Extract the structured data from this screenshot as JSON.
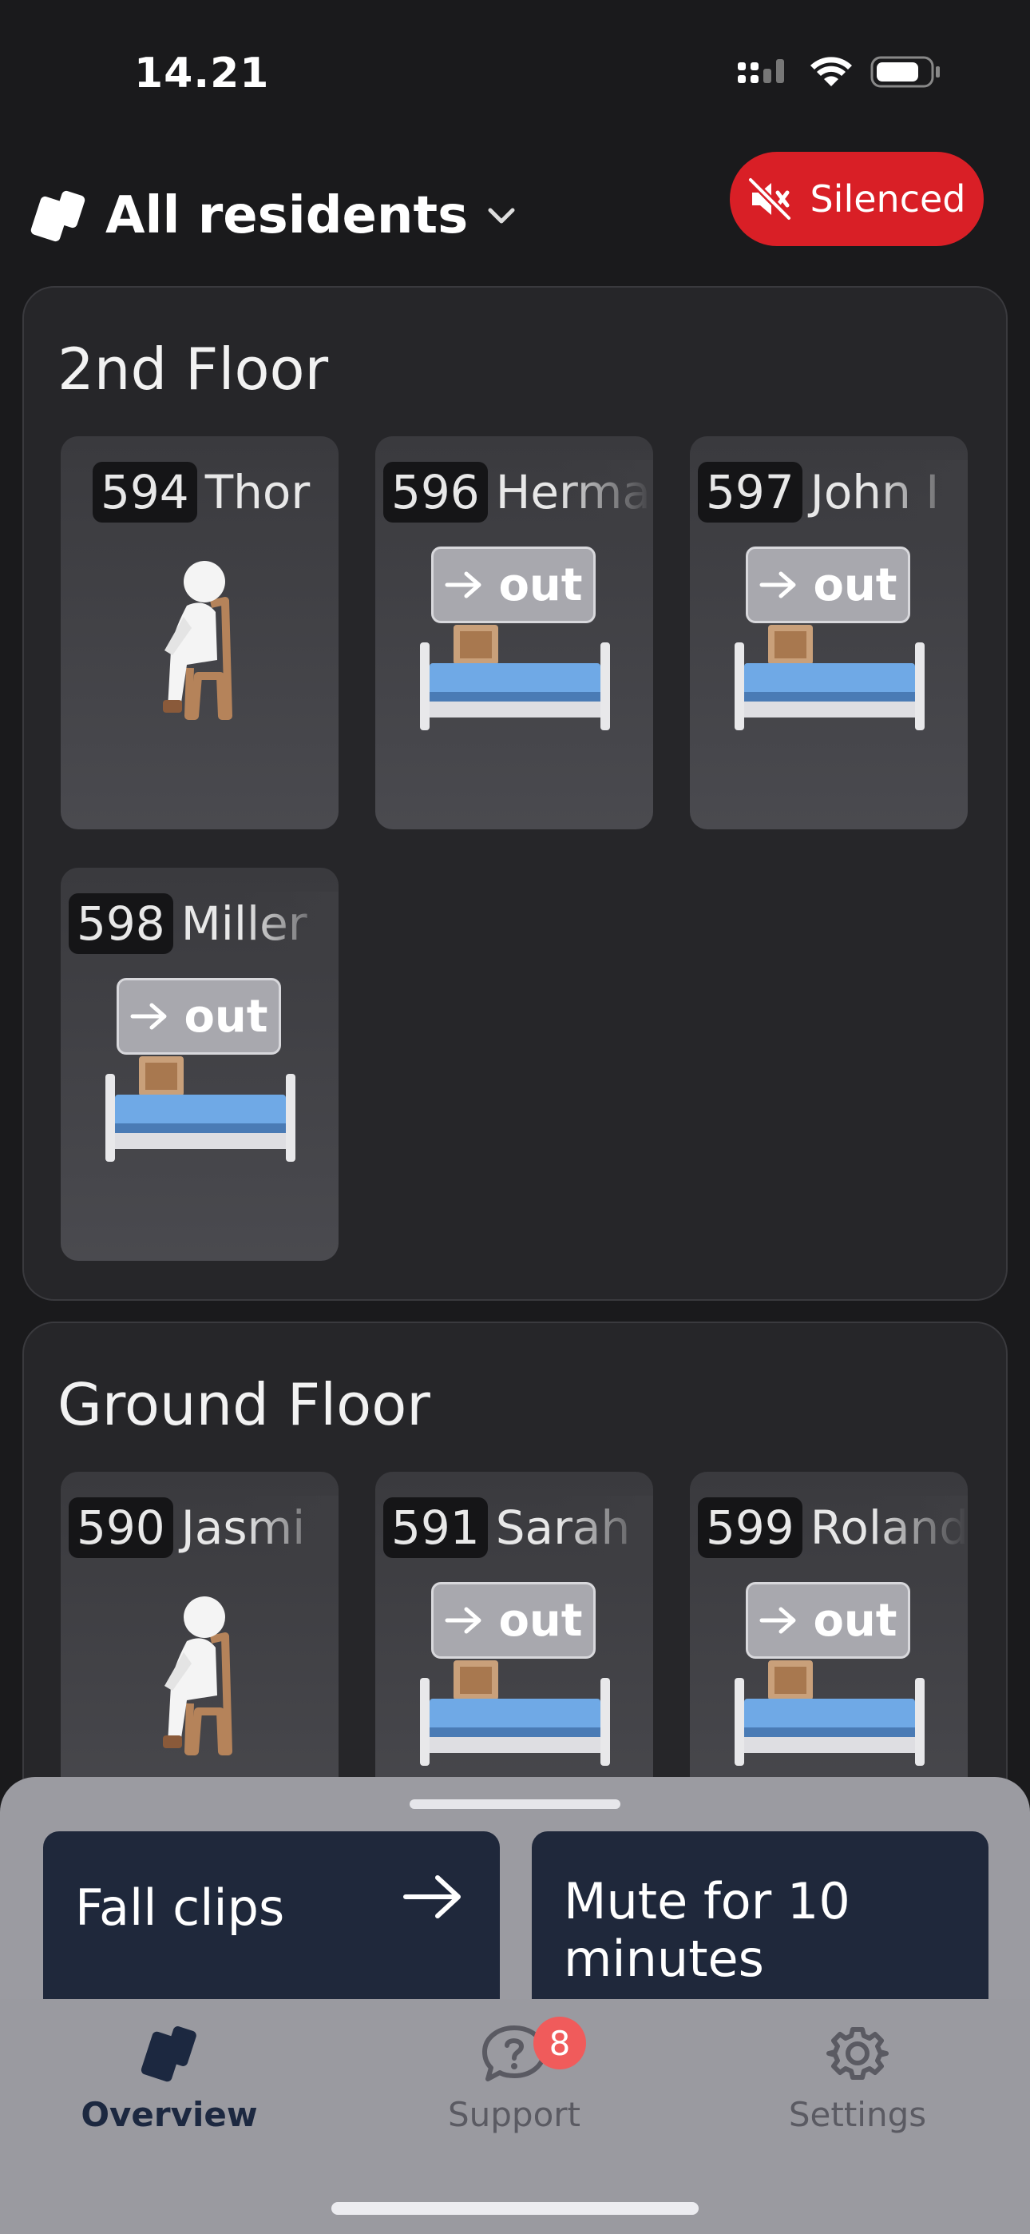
{
  "status_bar": {
    "time": "14.21"
  },
  "header": {
    "selector_label": "All residents",
    "silenced_label": "Silenced"
  },
  "floors": [
    {
      "name": "2nd Floor",
      "residents": [
        {
          "room": "594",
          "name": "Thor",
          "state": "sitting"
        },
        {
          "room": "596",
          "name": "Herma",
          "state": "out of bed",
          "badge": "out"
        },
        {
          "room": "597",
          "name": "John I",
          "state": "out of bed",
          "badge": "out"
        },
        {
          "room": "598",
          "name": "Miller",
          "state": "out of bed",
          "badge": "out"
        }
      ]
    },
    {
      "name": "Ground Floor",
      "residents": [
        {
          "room": "590",
          "name": "Jasmi",
          "state": "sitting"
        },
        {
          "room": "591",
          "name": "Sarah",
          "state": "out of bed",
          "badge": "out"
        },
        {
          "room": "599",
          "name": "Roland",
          "state": "out of bed",
          "badge": "out"
        }
      ]
    }
  ],
  "bottom_sheet": {
    "fall_clips_label": "Fall clips",
    "mute_label": "Mute for 10 minutes"
  },
  "tabs": [
    {
      "label": "Overview",
      "icon": "cards-icon",
      "active": true
    },
    {
      "label": "Support",
      "icon": "question-bubble-icon",
      "badge": "8"
    },
    {
      "label": "Settings",
      "icon": "gear-icon"
    }
  ],
  "colors": {
    "background": "#1a1a1c",
    "silenced": "#d91f26",
    "action_card": "#1f283b",
    "badge": "#f05b5b",
    "active_tab": "#1c2840"
  }
}
